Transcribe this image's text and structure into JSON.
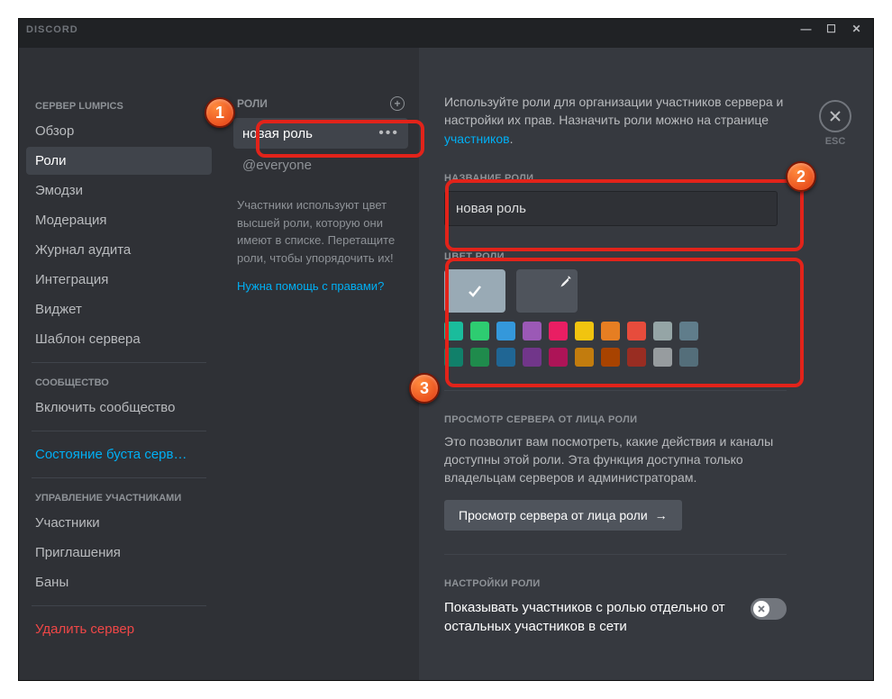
{
  "titlebar": {
    "brand": "DISCORD"
  },
  "esc": {
    "label": "ESC"
  },
  "sidebar": {
    "server_header": "СЕРВЕР LUMPICS",
    "items1": [
      {
        "label": "Обзор"
      },
      {
        "label": "Роли"
      },
      {
        "label": "Эмодзи"
      },
      {
        "label": "Модерация"
      },
      {
        "label": "Журнал аудита"
      },
      {
        "label": "Интеграция"
      },
      {
        "label": "Виджет"
      },
      {
        "label": "Шаблон сервера"
      }
    ],
    "community_header": "СООБЩЕСТВО",
    "community_item": "Включить сообщество",
    "boost_item": "Состояние буста серв…",
    "members_header": "УПРАВЛЕНИЕ УЧАСТНИКАМИ",
    "items3": [
      {
        "label": "Участники"
      },
      {
        "label": "Приглашения"
      },
      {
        "label": "Баны"
      }
    ],
    "delete": "Удалить сервер"
  },
  "roles_col": {
    "header": "РОЛИ",
    "selected_role": "новая роль",
    "everyone": "@everyone",
    "help": "Участники используют цвет высшей роли, которую они имеют в списке. Перетащите роли, чтобы упорядочить их!",
    "help_link": "Нужна помощь с правами?"
  },
  "main": {
    "intro": "Используйте роли для организации участников сервера и настройки их прав. Назначить роли можно на странице ",
    "intro_link": "участников",
    "name_label": "НАЗВАНИЕ РОЛИ",
    "name_value": "новая роль",
    "color_label": "ЦВЕТ РОЛИ",
    "colors": {
      "row1": [
        "#1abc9c",
        "#2ecc71",
        "#3498db",
        "#9b59b6",
        "#e91e63",
        "#f1c40f",
        "#e67e22",
        "#e74c3c",
        "#95a5a6",
        "#607d8b"
      ],
      "row2": [
        "#11806a",
        "#1f8b4c",
        "#206694",
        "#71368a",
        "#ad1457",
        "#c27c0e",
        "#a84300",
        "#992d22",
        "#979c9f",
        "#546e7a"
      ]
    },
    "preview_header": "ПРОСМОТР СЕРВЕРА ОТ ЛИЦА РОЛИ",
    "preview_desc": "Это позволит вам посмотреть, какие действия и каналы доступны этой роли. Эта функция доступна только владельцам серверов и администраторам.",
    "preview_btn": "Просмотр сервера от лица роли",
    "settings_header": "НАСТРОЙКИ РОЛИ",
    "setting1": "Показывать участников с ролью отдельно от остальных участников в сети"
  }
}
